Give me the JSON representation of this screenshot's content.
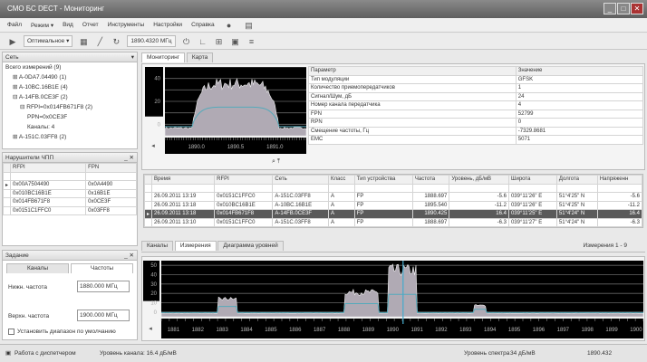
{
  "window": {
    "title": "СМО БС DECT",
    "subtitle": "Мониторинг",
    "min": "_",
    "max": "□",
    "close": "✕"
  },
  "menu": [
    "Файл",
    "Режим ▾",
    "Вид",
    "Отчет",
    "Инструменты",
    "Настройки",
    "Справка"
  ],
  "toolbar": {
    "mode": "Оптимальное ▾",
    "frequency": "1890.4320 МГц"
  },
  "network_panel": {
    "title": "Сеть",
    "items": [
      {
        "label": "Всего измерений (9)",
        "indent": 0
      },
      {
        "label": "⊞ A-0DA7.04490 (1)",
        "indent": 1
      },
      {
        "label": "⊞ A-10BC.16B1E (4)",
        "indent": 1
      },
      {
        "label": "⊟ A-14FB.0CE3F (2)",
        "indent": 1
      },
      {
        "label": "⊟ RFPI=0x014FB671F8 (2)",
        "indent": 2
      },
      {
        "label": "PPN=0x0CE3F",
        "indent": 3
      },
      {
        "label": "Каналы: 4",
        "indent": 3
      },
      {
        "label": "⊞ A-151C.03FF8 (2)",
        "indent": 1
      }
    ]
  },
  "violators_panel": {
    "title": "Нарушители ЧПП",
    "columns": [
      "RFPI",
      "FPN"
    ],
    "rows": [
      [
        "0x00A7504490",
        "0x0A4490"
      ],
      [
        "0x010BC16B1E",
        "0x16B1E"
      ],
      [
        "0x014FB671F8",
        "0x0CE3F"
      ],
      [
        "0x0151C1FFC0",
        "0x03FF8"
      ]
    ]
  },
  "task_panel": {
    "title": "Задание",
    "tabs": [
      "Каналы",
      "Частоты"
    ],
    "low_label": "Нижн. частота",
    "low_value": "1880.000 МГц",
    "high_label": "Верхн. частота",
    "high_value": "1900.000 МГц",
    "checkbox": "Установить диапазон по умолчанию"
  },
  "top_tabs": [
    "Мониторинг",
    "Карта"
  ],
  "params": {
    "columns": [
      "Параметр",
      "Значение"
    ],
    "rows": [
      [
        "Тип модуляции",
        "GFSK"
      ],
      [
        "Количество приемопередатчиков",
        "1"
      ],
      [
        "Сигнал/Шум, дБ",
        "24"
      ],
      [
        "Номер канала передатчика",
        "4"
      ],
      [
        "FPN",
        "52799"
      ],
      [
        "RPN",
        "0"
      ],
      [
        "Смещение частоты, Гц",
        "-7329.8681"
      ],
      [
        "EMC",
        "5071"
      ]
    ]
  },
  "meas_table": {
    "columns": [
      "Время",
      "RFPI",
      "Сеть",
      "Класс",
      "Тип устройства",
      "Частота",
      "Уровень, дБ/мВ",
      "Широта",
      "Долгота",
      "Напряженн"
    ],
    "rows": [
      [
        "26.09.2011 13:19",
        "0x0151C1FFC0",
        "A-151C.03FF8",
        "A",
        "FP",
        "1888.697",
        "-5.6",
        "039°11'26\" E",
        "51°4'25\" N",
        "-5.6"
      ],
      [
        "26.09.2011 13:18",
        "0x010BC16B1E",
        "A-10BC.16B1E",
        "A",
        "FP",
        "1895.540",
        "-11.2",
        "039°11'26\" E",
        "51°4'25\" N",
        "-11.2"
      ],
      [
        "26.09.2011 13:18",
        "0x014FB671F8",
        "A-14FB.0CE3F",
        "A",
        "FP",
        "1890.425",
        "16.4",
        "039°11'25\" E",
        "51°4'24\" N",
        "16.4"
      ],
      [
        "26.09.2011 13:10",
        "0x0151C1FFC0",
        "A-151C.03FF8",
        "A",
        "FP",
        "1888.697",
        "-6.3",
        "039°11'27\" E",
        "51°4'24\" N",
        "-6.3"
      ]
    ],
    "selected": 2
  },
  "bottom_tabs": [
    "Каналы",
    "Измерения",
    "Диаграмма уровней"
  ],
  "measurements_count": "Измерения 1 - 9",
  "status": {
    "mode": "Работа с диспетчером",
    "channel_level": "Уровень канала: 16.4 дБ/мВ",
    "spectrum_label": "Уровень спектра",
    "spectrum_value": "34 дБ/мВ",
    "freq": "1890.432"
  },
  "chart_data": [
    {
      "type": "area",
      "title": "Спектр канала",
      "xlabel": "МГц",
      "x_ticks": [
        "1890.0",
        "1890.5",
        "1891.0"
      ],
      "y_ticks": [
        "0",
        "20",
        "40"
      ],
      "xlim": [
        1889.6,
        1891.4
      ],
      "ylim": [
        -10,
        50
      ],
      "peak_level": 30
    },
    {
      "type": "area",
      "title": "Панорама",
      "x_ticks": [
        "1881",
        "1882",
        "1883",
        "1884",
        "1885",
        "1886",
        "1887",
        "1888",
        "1889",
        "1890",
        "1891",
        "1892",
        "1893",
        "1894",
        "1895",
        "1896",
        "1897",
        "1898",
        "1899",
        "1900"
      ],
      "y_ticks": [
        "0",
        "10",
        "20",
        "30",
        "40",
        "50"
      ],
      "xlim": [
        1880.5,
        1900.3
      ],
      "ylim": [
        -5,
        55
      ],
      "bursts": [
        {
          "center": 1883.2,
          "width": 0.8,
          "level": 12
        },
        {
          "center": 1888.7,
          "width": 1.4,
          "level": 18
        },
        {
          "center": 1890.4,
          "width": 1.2,
          "level": 38
        },
        {
          "center": 1893.6,
          "width": 0.5,
          "level": 6
        }
      ],
      "marker_freq": 1890.43,
      "marker_level": 55
    }
  ]
}
